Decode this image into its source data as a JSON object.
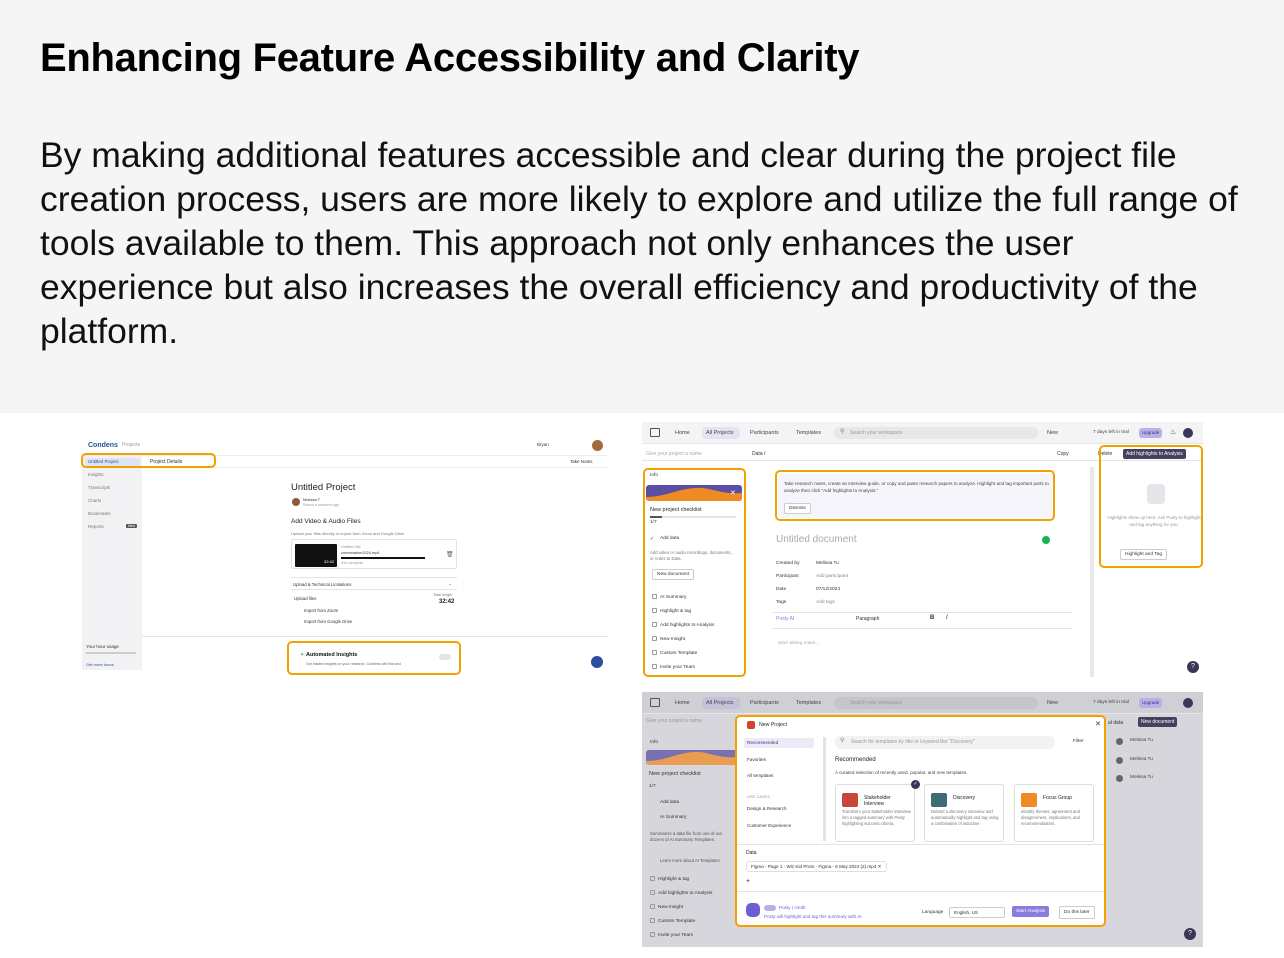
{
  "heading": "Enhancing Feature Accessibility and Clarity",
  "body": "By making additional features accessible and clear during the project file creation process, users are more likely to explore and utilize the full range of tools available to them. This approach not only enhances the user experience but also increases the overall efficiency and productivity of the platform.",
  "shot1": {
    "logo": "Condens",
    "logo_sub": "Projects",
    "user_name": "Bryan",
    "take_notes": "Take Notes",
    "project_details": "Project Details",
    "sidebar": [
      "Untitled Project",
      "Insights",
      "Transcripts",
      "Charts",
      "Bookmarks",
      "Reports"
    ],
    "reports_badge": "New",
    "title": "Untitled Project",
    "author": "Melissa T",
    "saved": "Saved a moment ago",
    "add_video": "Add Video & Audio Files",
    "add_video_sub": "Upload your files directly or import from Zoom and Google Drive",
    "file_label": "Untitled file",
    "file_name": "conversation2024.mp4",
    "file_pct": "4% complete",
    "clip_time": "32:42",
    "section": "Upload & Technical Limitations",
    "upload_items": [
      "Upload files",
      "Import from Zoom",
      "Import from Google Drive"
    ],
    "total_label": "Total length",
    "total": "32:42",
    "usage": "Your hour usage",
    "usage_sub": "Get more hours",
    "auto_title": "Automated Insights",
    "auto_sub": "Get instant insights on your research. Condens will find and"
  },
  "shot2": {
    "nav": [
      "Home",
      "All Projects",
      "Participants",
      "Templates"
    ],
    "search": "Search your workspace",
    "new": "New",
    "trial": "7 days left in trial",
    "upgrade": "Upgrade",
    "give_name": "Give your project a name",
    "crumb": "Data /",
    "copy": "Copy",
    "delete": "Delete",
    "add_highlights": "Add highlights to Analysis",
    "info": "Info",
    "checklist": "New project checklist",
    "checklist_count": "1/7",
    "add_data": "Add data",
    "add_data_sub": "Add video or audio recordings, documents, or notes to Data.",
    "new_document": "New document",
    "checklist_items": [
      "AI Summary",
      "Highlight & tag",
      "Add highlights to Analysis",
      "New Insight",
      "Custom Template",
      "Invite your Team"
    ],
    "notice": "Take research notes, create an interview guide, or copy and paste research papers to analyze. Highlight and tag important parts to analyze then click \"Add highlights to Analysis.\"",
    "dismiss": "Dismiss",
    "doc_title": "Untitled document",
    "fields": [
      {
        "label": "Created by",
        "value": "Melissa Tu"
      },
      {
        "label": "Participant",
        "value": "Add participant"
      },
      {
        "label": "Date",
        "value": "07/12/2024"
      },
      {
        "label": "Tags",
        "value": "Add tags"
      }
    ],
    "posty": "Posty AI",
    "paragraph": "Paragraph",
    "start": "Start taking notes...",
    "right_hint": "Highlights show up here. Ask Posty to highlight and tag anything for you.",
    "highlight_tag": "Highlight and Tag",
    "help": "?"
  },
  "shot3": {
    "nav": [
      "Home",
      "All Projects",
      "Participants",
      "Templates"
    ],
    "search": "Search your workspace",
    "new": "New",
    "trial": "7 days left in trial",
    "upgrade": "Upgrade",
    "give_name": "Give your project a name",
    "info": "Info",
    "checklist": "New project checklist",
    "checklist_count": "1/7",
    "add_data": "Add data",
    "ai_summary": "AI Summary",
    "ai_sub": "Summarize a data file from one of our dozens of AI Summary Templates.",
    "ai_learn": "Learn more about AI Templates",
    "checklist_items": [
      "Highlight & tag",
      "Add highlights to Analysis",
      "New Insight",
      "Custom Template",
      "Invite your Team"
    ],
    "right_new_doc": "New document",
    "right_data": "al data",
    "right_rows": [
      "Melissa Tu",
      "Melissa Tu",
      "Melissa Tu"
    ],
    "modal_project": "New Project",
    "modal_search": "Search for templates by title or keyword like \"Discovery\"",
    "filter": "Filter",
    "cats": [
      "Recommended",
      "Favorites",
      "All templates"
    ],
    "usecases": "USE CASES",
    "usecase_items": [
      "Design & Research",
      "Customer Experience"
    ],
    "rec_title": "Recommended",
    "rec_sub": "A curated selection of recently used, popular, and new templates.",
    "cards": [
      {
        "title": "Stakeholder Interview",
        "desc": "Transform your stakeholder interview into a tagged summary with Posty highlighting success criteria,",
        "color": "#c9473a"
      },
      {
        "title": "Discovery",
        "desc": "Debrief a discovery interview and automatically highlight and tag using a combination of inductive",
        "color": "#3f6b78"
      },
      {
        "title": "Focus Group",
        "desc": "Identify themes, agreement and disagreement, implications, and recommendations.",
        "color": "#f08a24"
      }
    ],
    "data_label": "Data",
    "file_chip": "Figma - Page 1 - Wiz Kid Proto - Figma - 6 May 2024 (2).mp4",
    "posty_credit": "Posty | credit",
    "posty_note": "Posty will highlight and tag this summary with AI",
    "language_label": "Language",
    "language": "English, US",
    "start_analysis": "Start Analysis",
    "do_later": "Do this later",
    "help": "?"
  },
  "colors": {
    "highlight": "#f4a100",
    "accent": "#8d7ce0",
    "dark_button": "#44405e"
  }
}
